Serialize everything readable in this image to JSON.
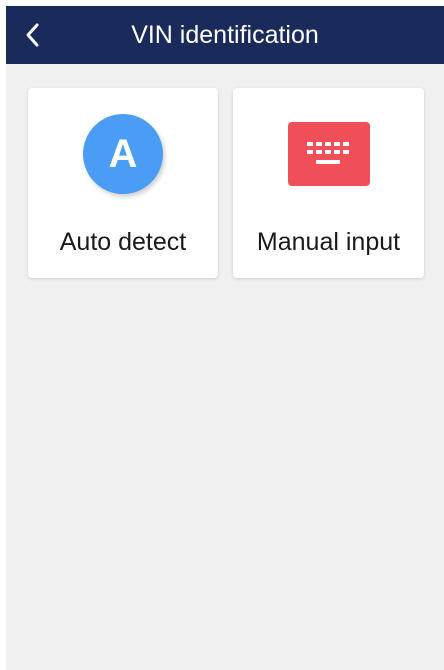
{
  "header": {
    "title": "VIN identification",
    "back_icon": "chevron-left-icon",
    "background_color": "#1a2b5b"
  },
  "options": {
    "auto_detect": {
      "label": "Auto detect",
      "icon_letter": "A",
      "icon": "auto-detect-icon",
      "icon_color": "#4a9cf5"
    },
    "manual_input": {
      "label": "Manual input",
      "icon": "keyboard-icon",
      "icon_color": "#f04e58"
    }
  }
}
